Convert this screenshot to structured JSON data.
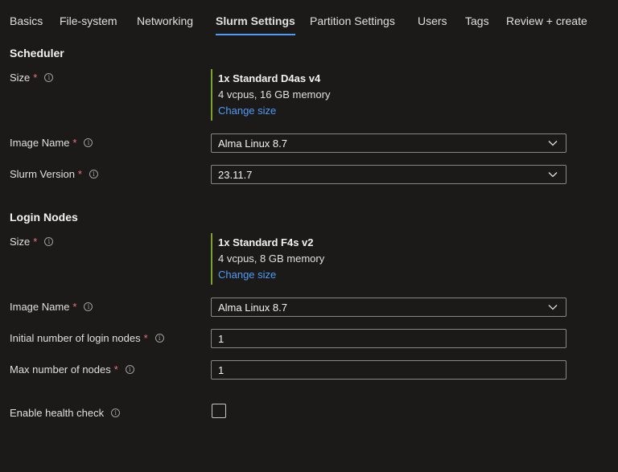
{
  "tabs": [
    {
      "label": "Basics"
    },
    {
      "label": "File-system"
    },
    {
      "label": "Networking"
    },
    {
      "label": "Slurm Settings"
    },
    {
      "label": "Partition Settings"
    },
    {
      "label": "Users"
    },
    {
      "label": "Tags"
    },
    {
      "label": "Review + create"
    }
  ],
  "active_tab": "Slurm Settings",
  "scheduler": {
    "title": "Scheduler",
    "size_label": "Size",
    "size_name": "1x Standard D4as v4",
    "size_spec": "4 vcpus, 16 GB memory",
    "change_size": "Change size",
    "image_label": "Image Name",
    "image_value": "Alma Linux 8.7",
    "slurm_label": "Slurm Version",
    "slurm_value": "23.11.7"
  },
  "login": {
    "title": "Login Nodes",
    "size_label": "Size",
    "size_name": "1x Standard F4s v2",
    "size_spec": "4 vcpus, 8 GB memory",
    "change_size": "Change size",
    "image_label": "Image Name",
    "image_value": "Alma Linux 8.7",
    "initial_label": "Initial number of login nodes",
    "initial_value": "1",
    "max_label": "Max number of nodes",
    "max_value": "1"
  },
  "health_check": {
    "label": "Enable health check",
    "checked": false
  },
  "required_marker": "*",
  "colors": {
    "background": "#1b1a19",
    "accent": "#4f9cf7",
    "required": "#f1707b",
    "size_bar": "#7ba32e"
  },
  "icons": {
    "info": "info-icon",
    "dropdown": "chevron-down-icon"
  }
}
